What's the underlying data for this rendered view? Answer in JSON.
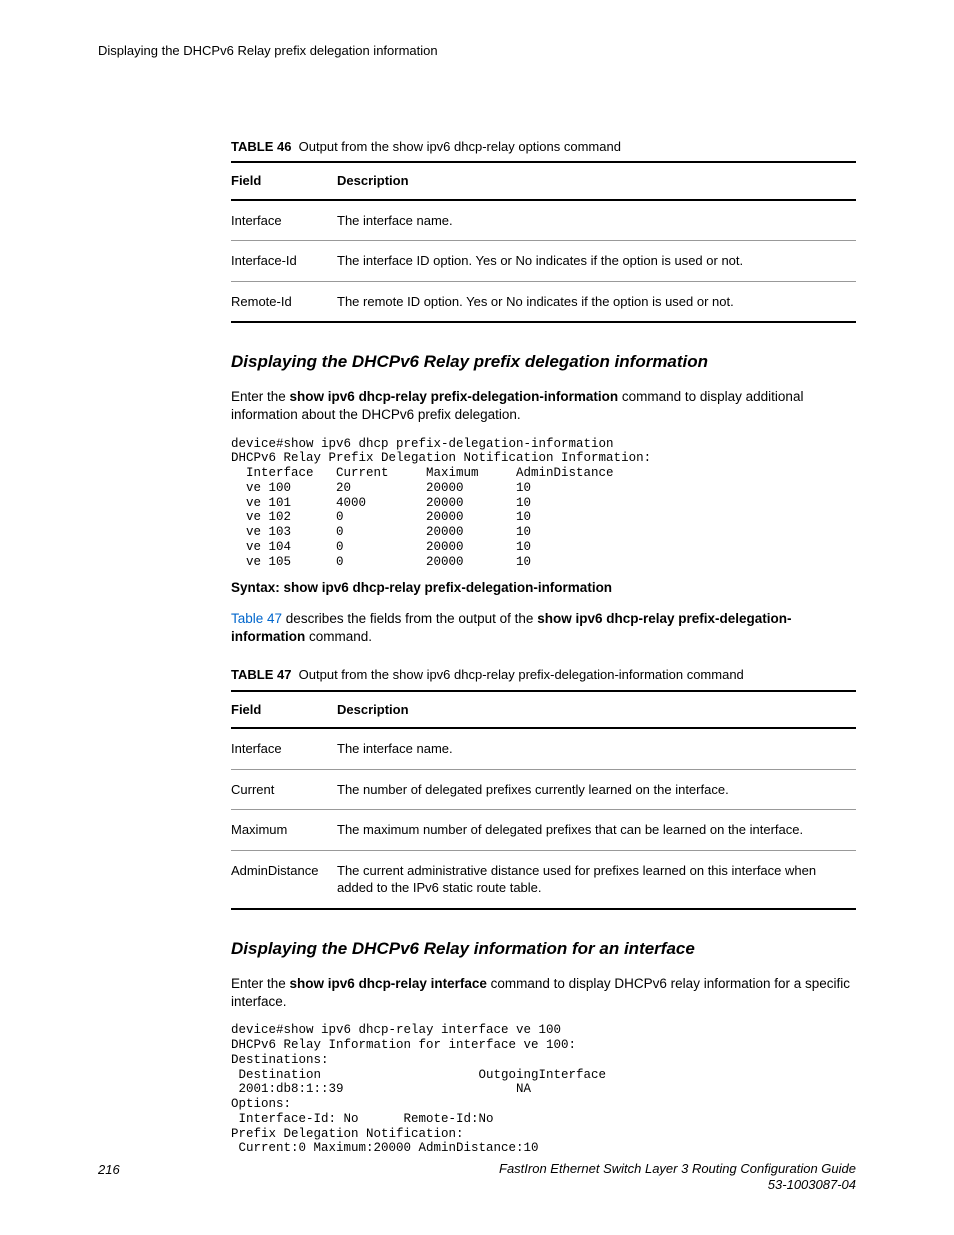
{
  "running_head": "Displaying the DHCPv6 Relay prefix delegation information",
  "table46": {
    "label": "TABLE 46",
    "caption": "Output from the show ipv6 dhcp-relay options command",
    "head_field": "Field",
    "head_desc": "Description",
    "rows": [
      {
        "field": "Interface",
        "desc": "The interface name."
      },
      {
        "field": "Interface-Id",
        "desc": "The interface ID option. Yes or No indicates if the option is used or not."
      },
      {
        "field": "Remote-Id",
        "desc": "The remote ID option. Yes or No indicates if the option is used or not."
      }
    ]
  },
  "section1": {
    "heading": "Displaying the DHCPv6 Relay prefix delegation information",
    "intro_pre": "Enter the ",
    "intro_cmd": "show ipv6 dhcp-relay prefix-delegation-information",
    "intro_post": " command to display additional information about the DHCPv6 prefix delegation.",
    "terminal": "device#show ipv6 dhcp prefix-delegation-information\nDHCPv6 Relay Prefix Delegation Notification Information:\n  Interface   Current     Maximum     AdminDistance\n  ve 100      20          20000       10\n  ve 101      4000        20000       10\n  ve 102      0           20000       10\n  ve 103      0           20000       10\n  ve 104      0           20000       10\n  ve 105      0           20000       10",
    "syntax": "Syntax: show ipv6 dhcp-relay prefix-delegation-information",
    "ref_link": "Table 47 ",
    "ref_mid": "describes the fields from the output of the ",
    "ref_cmd": "show ipv6 dhcp-relay prefix-delegation-information",
    "ref_post": " command."
  },
  "table47": {
    "label": "TABLE 47",
    "caption": "Output from the show ipv6 dhcp-relay prefix-delegation-information command",
    "head_field": "Field",
    "head_desc": "Description",
    "rows": [
      {
        "field": "Interface",
        "desc": "The interface name."
      },
      {
        "field": "Current",
        "desc": "The number of delegated prefixes currently learned on the interface."
      },
      {
        "field": "Maximum",
        "desc": "The maximum number of delegated prefixes that can be learned on the interface."
      },
      {
        "field": "AdminDistance",
        "desc": "The current administrative distance used for prefixes learned on this interface when added to the IPv6 static route table."
      }
    ]
  },
  "section2": {
    "heading": "Displaying the DHCPv6 Relay information for an interface",
    "intro_pre": "Enter the ",
    "intro_cmd": "show ipv6 dhcp-relay interface",
    "intro_post": " command to display DHCPv6 relay information for a specific interface.",
    "terminal": "device#show ipv6 dhcp-relay interface ve 100\nDHCPv6 Relay Information for interface ve 100:\nDestinations:\n Destination                     OutgoingInterface\n 2001:db8:1::39                       NA\nOptions:\n Interface-Id: No      Remote-Id:No\nPrefix Delegation Notification:\n Current:0 Maximum:20000 AdminDistance:10"
  },
  "footer": {
    "page": "216",
    "title": "FastIron Ethernet Switch Layer 3 Routing Configuration Guide",
    "docnum": "53-1003087-04"
  }
}
